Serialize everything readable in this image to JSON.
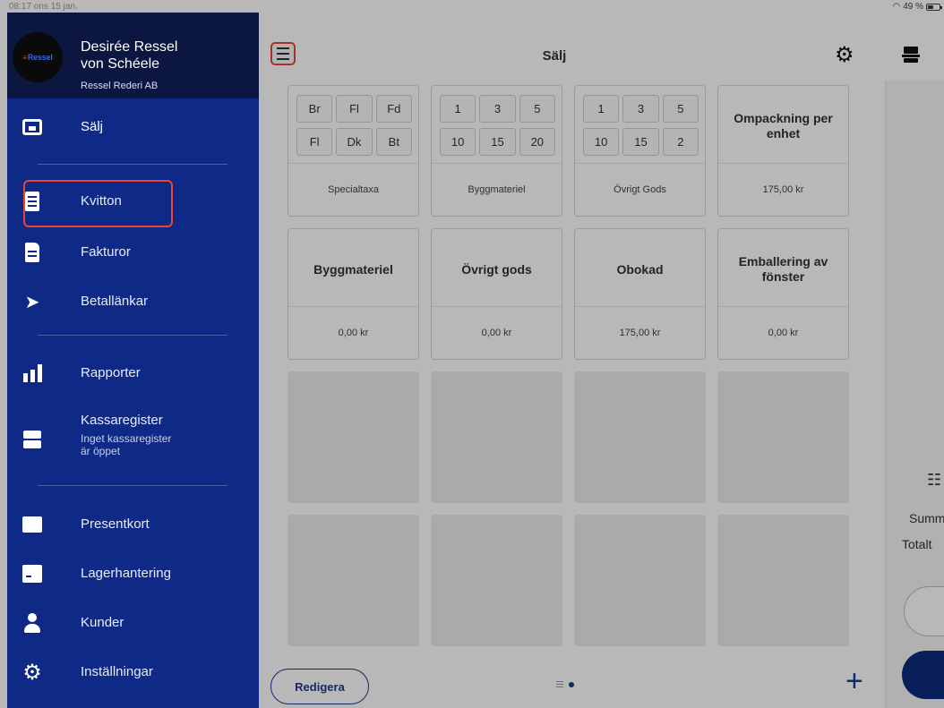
{
  "status_bar": {
    "time": "08:17  ons 15 jan.",
    "battery": "49 %"
  },
  "header": {
    "title": "Sälj"
  },
  "user": {
    "name_line1": "Desirée Ressel",
    "name_line2": "von Schéele",
    "company": "Ressel Rederi AB",
    "logo_text": "Ressel"
  },
  "sidebar": {
    "items": [
      {
        "label": "Sälj",
        "icon": "store-icon"
      },
      {
        "label": "Kvitton",
        "icon": "receipt-icon"
      },
      {
        "label": "Fakturor",
        "icon": "invoice-icon"
      },
      {
        "label": "Betallänkar",
        "icon": "send-icon"
      },
      {
        "label": "Rapporter",
        "icon": "chart-icon"
      },
      {
        "label": "Kassaregister",
        "sub_line1": "Inget kassaregister",
        "sub_line2": "är öppet",
        "icon": "register-icon"
      },
      {
        "label": "Presentkort",
        "icon": "gift-card-icon"
      },
      {
        "label": "Lagerhantering",
        "icon": "inventory-icon"
      },
      {
        "label": "Kunder",
        "icon": "person-icon"
      },
      {
        "label": "Inställningar",
        "icon": "gear-icon"
      }
    ]
  },
  "tiles": [
    {
      "type": "group",
      "keys": [
        "Br",
        "Fl",
        "Fd",
        "Fl",
        "Dk",
        "Bt"
      ],
      "footer": "Specialtaxa"
    },
    {
      "type": "group",
      "keys": [
        "1",
        "3",
        "5",
        "10",
        "15",
        "20"
      ],
      "footer": "Byggmateriel"
    },
    {
      "type": "group",
      "keys": [
        "1",
        "3",
        "5",
        "10",
        "15",
        "2"
      ],
      "footer": "Övrigt Gods"
    },
    {
      "type": "product",
      "title": "Ompackning per enhet",
      "price": "175,00 kr"
    },
    {
      "type": "product",
      "title": "Byggmateriel",
      "price": "0,00 kr"
    },
    {
      "type": "product",
      "title": "Övrigt gods",
      "price": "0,00 kr"
    },
    {
      "type": "product",
      "title": "Obokad",
      "price": "175,00 kr"
    },
    {
      "type": "product",
      "title": "Emballering av fönster",
      "price": "0,00 kr"
    }
  ],
  "right_panel": {
    "summary_label": "Summ",
    "total_label": "Totalt"
  },
  "bottom": {
    "edit_label": "Redigera",
    "add_symbol": "+"
  },
  "colors": {
    "sidebar_bg": "#0f2a86",
    "sidebar_header_bg": "#0b1740",
    "highlight": "#e8453c",
    "accent": "#1c3a8f"
  }
}
